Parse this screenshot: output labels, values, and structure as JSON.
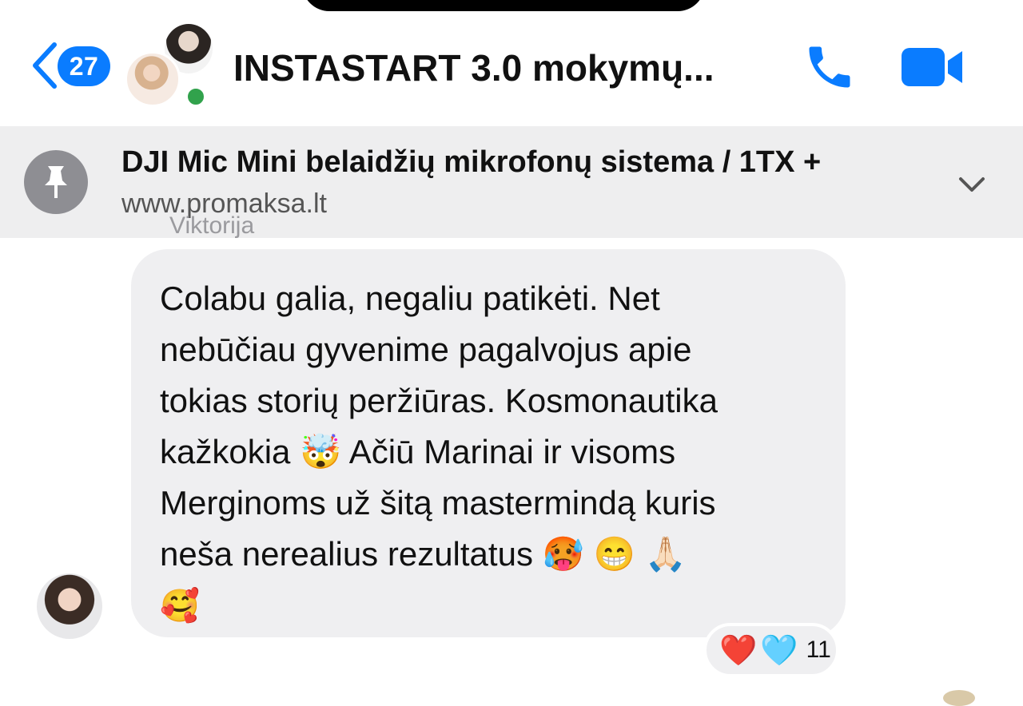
{
  "header": {
    "back_count": "27",
    "title": "INSTASTART 3.0 mokymų...",
    "online": true
  },
  "pinned": {
    "title": "DJI Mic Mini belaidžių mikrofonų sistema / 1TX +",
    "url": "www.promaksa.lt"
  },
  "message": {
    "sender": "Viktorija",
    "lines": [
      "Colabu galia, negaliu patikėti. Net",
      "nebūčiau gyvenime pagalvojus apie",
      "tokias storių peržiūras. Kosmonautika",
      "kažkokia 🤯 Ačiū Marinai ir visoms",
      "Merginoms už šitą mastermindą kuris",
      "neša nerealius rezultatus 🥵 😁 🙏🏻",
      "🥰"
    ]
  },
  "reactions": {
    "emojis": [
      "❤️",
      "🩵"
    ],
    "count": "11"
  },
  "colors": {
    "accent": "#0a7cff",
    "online": "#31a24c",
    "bubble": "#efeff1",
    "pinned_bg": "#eeeeef"
  }
}
